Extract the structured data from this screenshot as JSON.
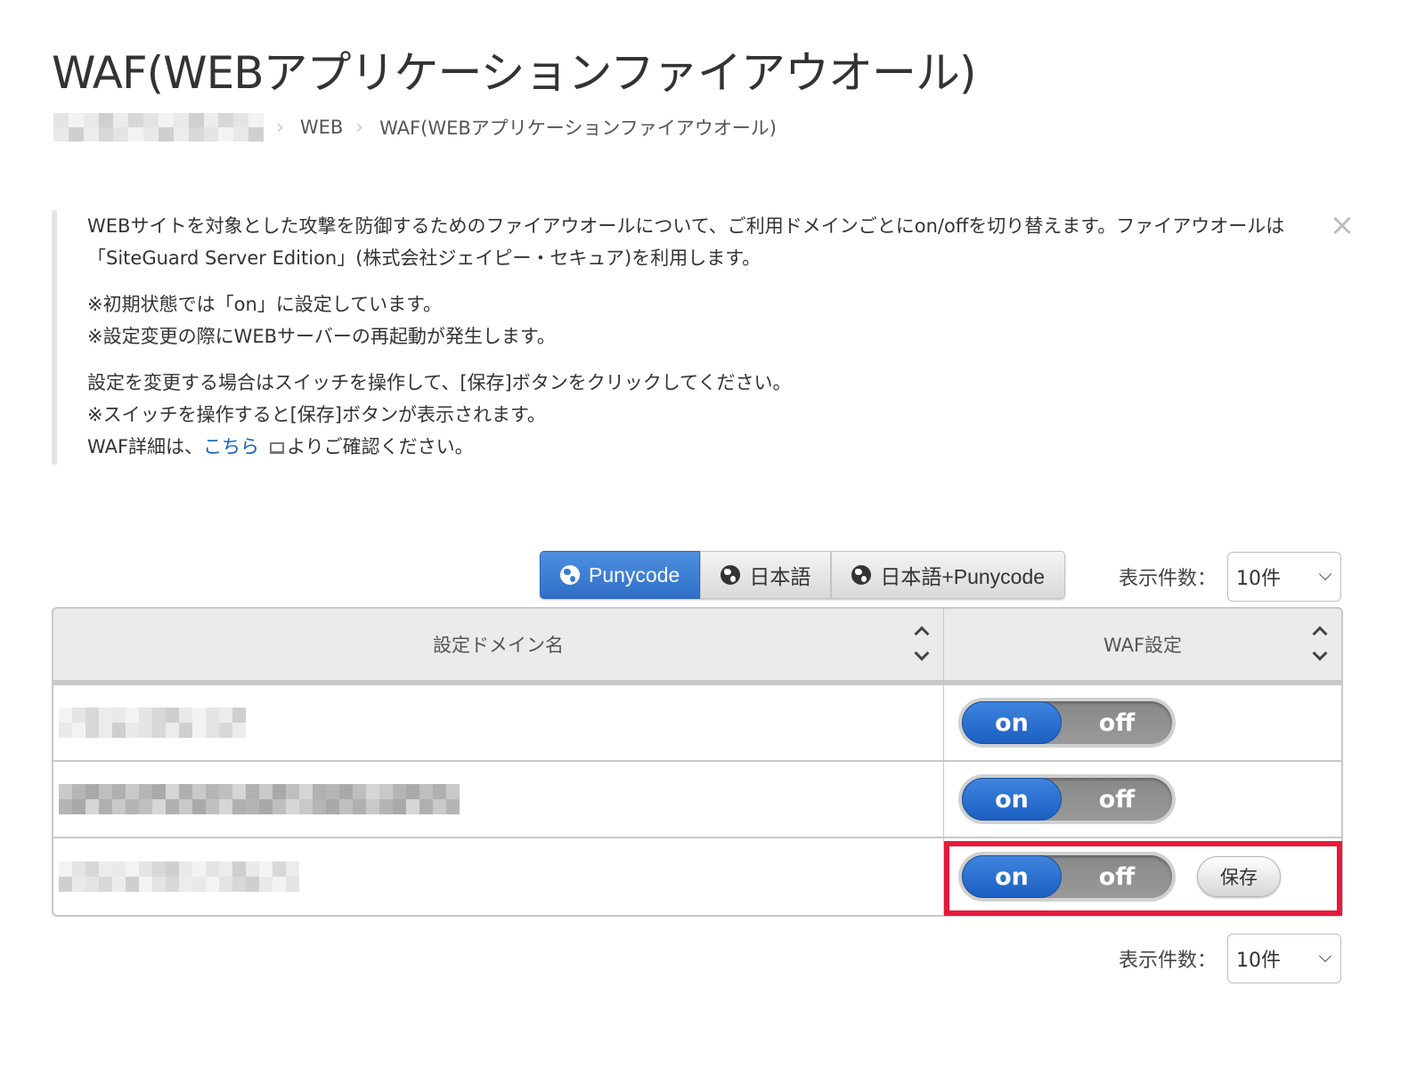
{
  "page": {
    "title": "WAF(WEBアプリケーションファイアウオール)"
  },
  "breadcrumb": {
    "items": [
      {
        "label": "WEB"
      },
      {
        "label": "WAF(WEBアプリケーションファイアウオール)"
      }
    ],
    "separator": "›"
  },
  "info": {
    "paragraph1": "WEBサイトを対象とした攻撃を防御するためのファイアウオールについて、ご利用ドメインごとにon/offを切り替えます。ファイアウオールは「SiteGuard Server Edition」(株式会社ジェイピー・セキュア)を利用します。",
    "note1": "※初期状態では「on」に設定しています。",
    "note2": "※設定変更の際にWEBサーバーの再起動が発生します。",
    "instruction1": "設定を変更する場合はスイッチを操作して、[保存]ボタンをクリックしてください。",
    "instruction2": "※スイッチを操作すると[保存]ボタンが表示されます。",
    "detail_prefix": "WAF詳細は、",
    "detail_link": "こちら",
    "detail_suffix": "よりご確認ください。",
    "close_glyph": "×"
  },
  "filters": {
    "options": [
      {
        "label": "Punycode",
        "active": true
      },
      {
        "label": "日本語",
        "active": false
      },
      {
        "label": "日本語+Punycode",
        "active": false
      }
    ]
  },
  "per_page": {
    "label": "表示件数：",
    "value": "10件"
  },
  "table": {
    "columns": [
      {
        "label": "設定ドメイン名"
      },
      {
        "label": "WAF設定"
      }
    ],
    "rows": [
      {
        "domain_blurred": true,
        "waf_state": "on",
        "on_label": "on",
        "off_label": "off",
        "show_save": false
      },
      {
        "domain_blurred": true,
        "waf_state": "on",
        "on_label": "on",
        "off_label": "off",
        "show_save": false
      },
      {
        "domain_blurred": true,
        "waf_state": "on",
        "on_label": "on",
        "off_label": "off",
        "show_save": true,
        "save_label": "保存"
      }
    ]
  },
  "colors": {
    "accent_blue": "#2f6fc8",
    "link_blue": "#1a63b8",
    "highlight_red": "#e6193c",
    "toggle_off_gray": "#909090"
  }
}
